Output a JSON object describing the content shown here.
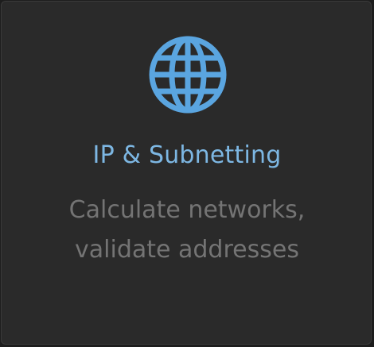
{
  "card": {
    "icon": "globe-icon",
    "accent_color": "#5aa5e0",
    "title": "IP & Subnetting",
    "description_line1": "Calculate networks,",
    "description_line2": "validate addresses"
  }
}
